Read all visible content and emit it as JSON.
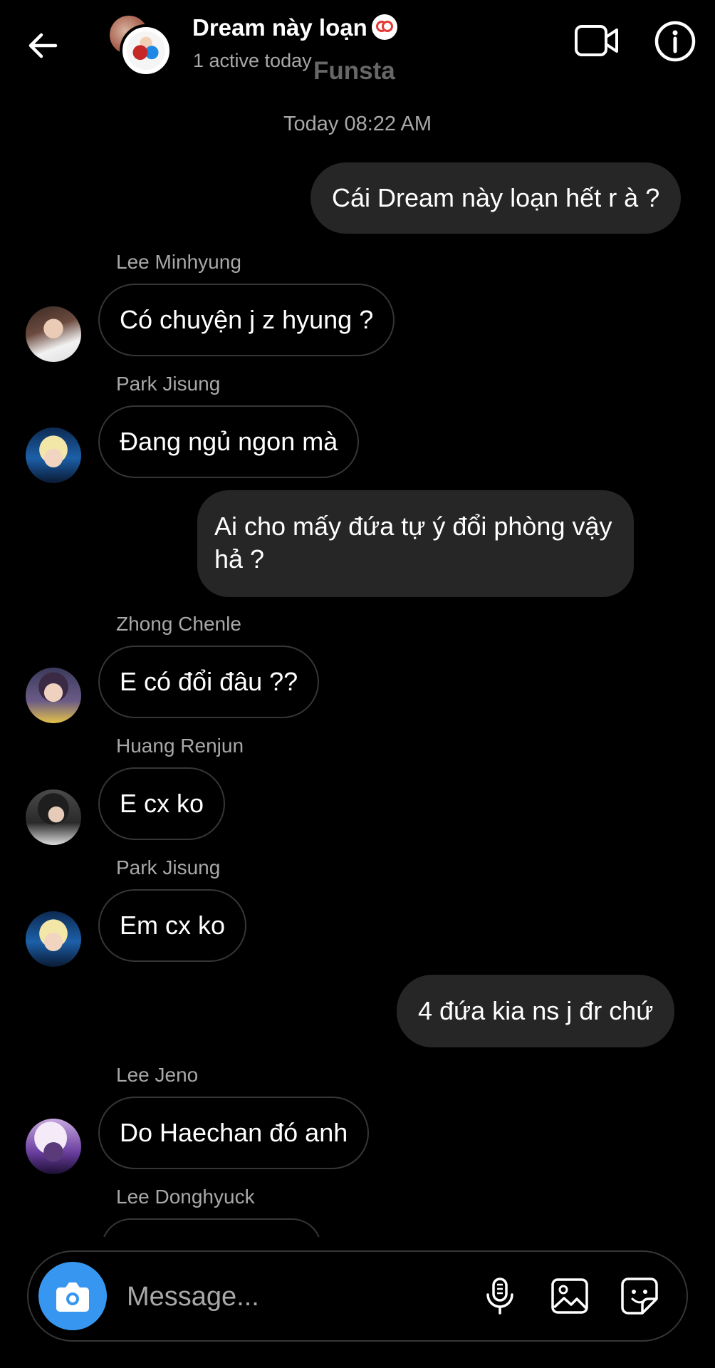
{
  "header": {
    "title": "Dream này loạn",
    "title_emoji": "clown-face-emoji",
    "subtitle": "1 active today",
    "watermark": "Funsta",
    "back_icon": "arrow-left-icon",
    "video_icon": "video-camera-icon",
    "info_icon": "info-circle-icon"
  },
  "timestamp": "Today 08:22 AM",
  "messages": {
    "m1": {
      "text": "Cái Dream này loạn hết r à ?"
    },
    "m2": {
      "sender": "Lee Minhyung",
      "text": "Có chuyện j z hyung ?"
    },
    "m3": {
      "sender": "Park Jisung",
      "text": "Đang ngủ ngon mà"
    },
    "m4": {
      "line1": "Ai cho mấy đứa tự ý đổi phòng vậy",
      "line2": "hả ?"
    },
    "m5": {
      "sender": "Zhong Chenle",
      "text": "E có đổi đâu ??"
    },
    "m6": {
      "sender": "Huang Renjun",
      "text": "E cx ko"
    },
    "m7": {
      "sender": "Park Jisung",
      "text": "Em cx ko"
    },
    "m8": {
      "text": "4 đứa kia ns j đr chứ"
    },
    "m9": {
      "sender": "Lee Jeno",
      "text": "Do Haechan đó anh"
    },
    "m10": {
      "sender": "Lee Donghyuck"
    }
  },
  "composer": {
    "placeholder": "Message...",
    "camera_icon": "camera-icon",
    "mic_icon": "microphone-icon",
    "gallery_icon": "image-gallery-icon",
    "sticker_icon": "sticker-icon"
  },
  "colors": {
    "background": "#000000",
    "outgoing_bubble": "#262626",
    "incoming_border": "#363636",
    "secondary_text": "#a8a8a8",
    "accent": "#3797f0"
  }
}
